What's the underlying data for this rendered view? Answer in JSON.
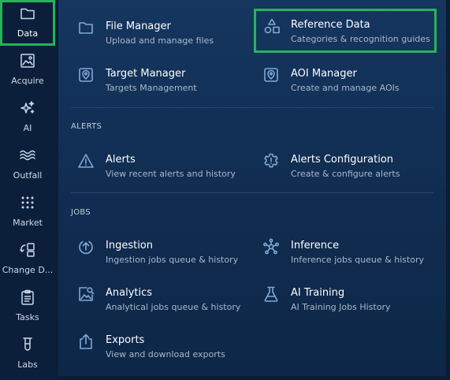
{
  "sidebar": {
    "items": [
      {
        "label": "Data",
        "icon": "folder-icon",
        "active": true
      },
      {
        "label": "Acquire",
        "icon": "image-icon"
      },
      {
        "label": "AI",
        "icon": "sparkles-icon"
      },
      {
        "label": "Outfall",
        "icon": "waves-icon"
      },
      {
        "label": "Market",
        "icon": "grid-dots-icon"
      },
      {
        "label": "Change D...",
        "icon": "change-detection-icon"
      },
      {
        "label": "Tasks",
        "icon": "clipboard-icon"
      },
      {
        "label": "Labs",
        "icon": "test-tube-icon"
      }
    ]
  },
  "menu": {
    "data_items": [
      {
        "title": "File Manager",
        "subtitle": "Upload and manage files",
        "icon": "folder-icon"
      },
      {
        "title": "Reference Data",
        "subtitle": "Categories & recognition guides",
        "icon": "shapes-icon"
      },
      {
        "title": "Target Manager",
        "subtitle": "Targets Management",
        "icon": "location-pin-icon"
      },
      {
        "title": "AOI Manager",
        "subtitle": "Create and manage AOIs",
        "icon": "location-pin-icon"
      }
    ],
    "alerts_section": "ALERTS",
    "alerts_items": [
      {
        "title": "Alerts",
        "subtitle": "View recent alerts and history",
        "icon": "warning-icon"
      },
      {
        "title": "Alerts Configuration",
        "subtitle": "Create & configure alerts",
        "icon": "gear-alert-icon"
      }
    ],
    "jobs_section": "JOBS",
    "jobs_items": [
      {
        "title": "Ingestion",
        "subtitle": "Ingestion jobs queue & history",
        "icon": "upload-circle-icon"
      },
      {
        "title": "Inference",
        "subtitle": "Inference jobs queue & history",
        "icon": "network-icon"
      },
      {
        "title": "Analytics",
        "subtitle": "Analytical jobs queue & history",
        "icon": "image-search-icon"
      },
      {
        "title": "AI Training",
        "subtitle": "AI Training Jobs History",
        "icon": "flask-icon"
      },
      {
        "title": "Exports",
        "subtitle": "View and download exports",
        "icon": "export-icon"
      }
    ]
  },
  "colors": {
    "highlight": "#27b35a",
    "panel": "#15365f",
    "sidebar": "#0c1f3a",
    "icon": "#7fa8d6"
  }
}
